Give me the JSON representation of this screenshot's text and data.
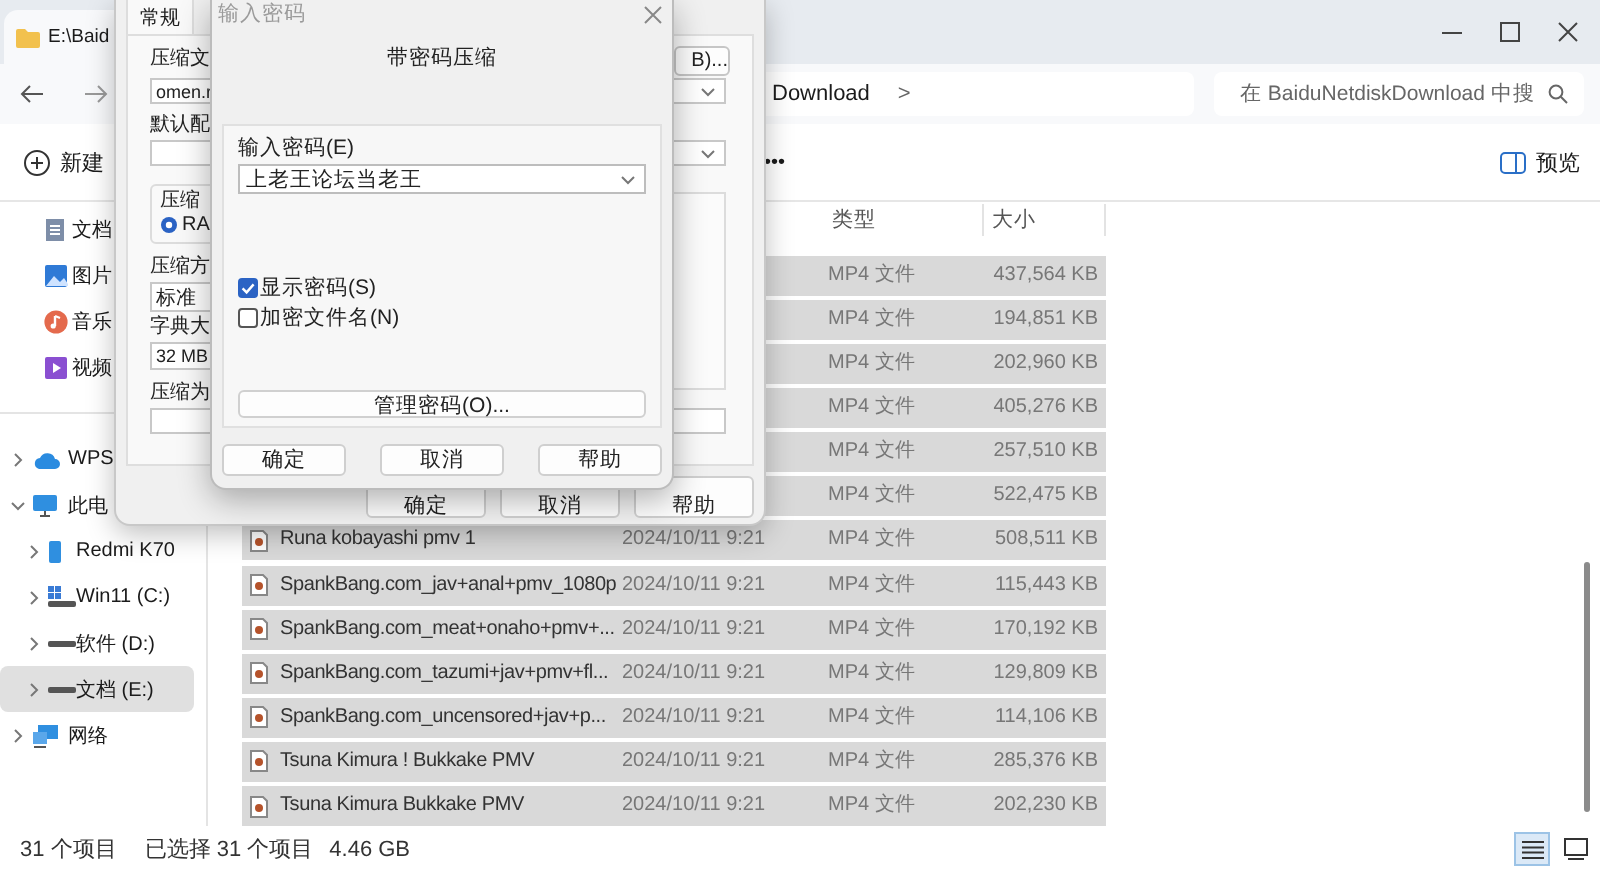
{
  "explorer": {
    "tab": {
      "title": "E:\\Baid"
    },
    "address": {
      "segment": "Download",
      "separator": ">"
    },
    "search": {
      "placeholder": "在 BaiduNetdiskDownload 中搜"
    },
    "toolbar": {
      "new": "新建",
      "more": "•••",
      "preview": "预览"
    },
    "sidebar": {
      "quick": [
        {
          "label": "文档",
          "kind": "documents"
        },
        {
          "label": "图片",
          "kind": "pictures"
        },
        {
          "label": "音乐",
          "kind": "music"
        },
        {
          "label": "视频",
          "kind": "videos"
        }
      ],
      "tree": [
        {
          "label": "WPS",
          "kind": "cloud",
          "expanded": false,
          "selected": false
        },
        {
          "label": "此电",
          "kind": "pc",
          "expanded": true,
          "selected": false,
          "children": [
            {
              "label": "Redmi K70",
              "kind": "phone",
              "expanded": false,
              "selected": false
            },
            {
              "label": "Win11 (C:)",
              "kind": "system-drive",
              "expanded": false,
              "selected": false
            },
            {
              "label": "软件 (D:)",
              "kind": "drive",
              "expanded": false,
              "selected": false
            },
            {
              "label": "文档 (E:)",
              "kind": "drive",
              "expanded": false,
              "selected": true
            }
          ]
        },
        {
          "label": "网络",
          "kind": "network",
          "expanded": false,
          "selected": false
        }
      ]
    },
    "columns": [
      "类型",
      "大小"
    ],
    "rows": [
      {
        "type": "MP4 文件",
        "size": "437,564 KB",
        "selected": true
      },
      {
        "type": "MP4 文件",
        "size": "194,851 KB",
        "selected": true
      },
      {
        "type": "MP4 文件",
        "size": "202,960 KB",
        "selected": true
      },
      {
        "type": "MP4 文件",
        "size": "405,276 KB",
        "selected": true
      },
      {
        "type": "MP4 文件",
        "size": "257,510 KB",
        "selected": true
      },
      {
        "type": "MP4 文件",
        "size": "522,475 KB",
        "selected": true
      },
      {
        "name": "Runa kobayashi pmv 1",
        "date": "2024/10/11 9:21",
        "type": "MP4 文件",
        "size": "508,511 KB",
        "selected": true
      },
      {
        "name": "SpankBang.com_jav+anal+pmv_1080p",
        "date": "2024/10/11 9:21",
        "type": "MP4 文件",
        "size": "115,443 KB",
        "selected": true
      },
      {
        "name": "SpankBang.com_meat+onaho+pmv+...",
        "date": "2024/10/11 9:21",
        "type": "MP4 文件",
        "size": "170,192 KB",
        "selected": true
      },
      {
        "name": "SpankBang.com_tazumi+jav+pmv+fl...",
        "date": "2024/10/11 9:21",
        "type": "MP4 文件",
        "size": "129,809 KB",
        "selected": true
      },
      {
        "name": "SpankBang.com_uncensored+jav+p...",
        "date": "2024/10/11 9:21",
        "type": "MP4 文件",
        "size": "114,106 KB",
        "selected": true
      },
      {
        "name": "Tsuna Kimura ! Bukkake PMV",
        "date": "2024/10/11 9:21",
        "type": "MP4 文件",
        "size": "285,376 KB",
        "selected": true
      },
      {
        "name": "Tsuna Kimura Bukkake PMV",
        "date": "2024/10/11 9:21",
        "type": "MP4 文件",
        "size": "202,230 KB",
        "selected": true
      }
    ],
    "status_bar": {
      "count": "31 个项目",
      "selection": "已选择 31 个项目",
      "total": "4.46 GB"
    },
    "view_modes": [
      {
        "kind": "details",
        "selected": true
      },
      {
        "kind": "tiles",
        "selected": false
      }
    ]
  },
  "archive_dialog": {
    "tab": "常规",
    "browse_button": "B)...",
    "archive_name_label": "压缩文",
    "archive_name": "omen.r",
    "profile_label": "默认配",
    "format_label": "压缩",
    "formats": [
      {
        "label": "RA",
        "selected": true
      }
    ],
    "method_label": "压缩方",
    "method": "标准",
    "dictionary_label": "字典大",
    "dictionary": "32 MB",
    "update_label": "压缩为",
    "buttons": [
      "确定",
      "取消",
      "帮助"
    ]
  },
  "password_dialog": {
    "title": "输入密码",
    "heading": "带密码压缩",
    "password_label": "输入密码(E)",
    "password": "上老王论坛当老王",
    "options": [
      {
        "label": "显示密码(S)",
        "checked": true
      },
      {
        "label": "加密文件名(N)",
        "checked": false
      }
    ],
    "manage_button": "管理密码(O)...",
    "buttons": [
      "确定",
      "取消",
      "帮助"
    ]
  }
}
